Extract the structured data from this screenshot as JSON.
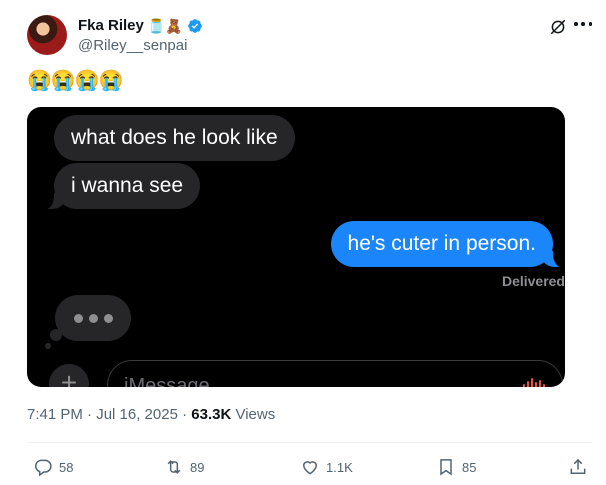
{
  "author": {
    "name": "Fka Riley",
    "name_emojis": "🫙🧸",
    "handle": "@Riley__senpai"
  },
  "tweet": {
    "text": "😭😭😭😭"
  },
  "messages": {
    "incoming_1": "what does he look like",
    "incoming_2": "i wanna see",
    "outgoing_1": "he's cuter in person.",
    "delivered_label": "Delivered",
    "input_placeholder": "iMessage",
    "plus_label": "+"
  },
  "meta": {
    "time_date": "7:41 PM · Jul 16, 2025 · ",
    "views_count": "63.3K",
    "views_label": " Views"
  },
  "actions": {
    "replies": "58",
    "reposts": "89",
    "likes": "1.1K",
    "bookmarks": "85"
  },
  "colors": {
    "verified": "#1d9bf0",
    "imessage_blue": "#1b86fb",
    "incoming_gray": "#262629",
    "secondary_text": "#536471"
  }
}
